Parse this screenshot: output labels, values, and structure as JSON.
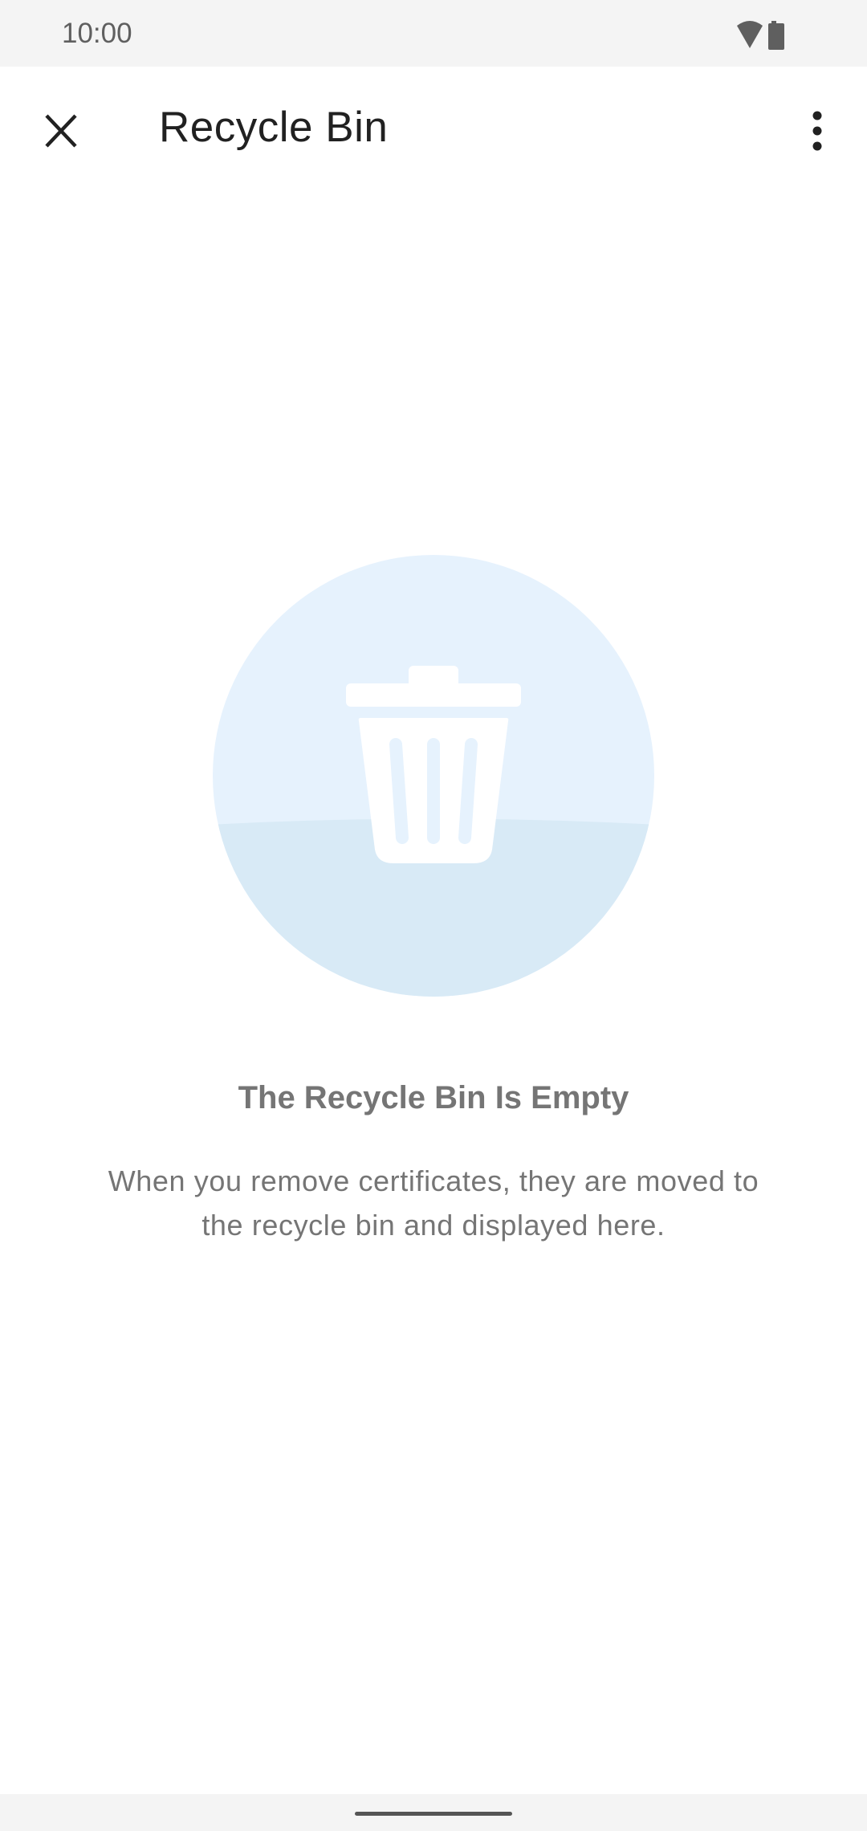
{
  "status_bar": {
    "time": "10:00",
    "icons": [
      "wifi-icon",
      "battery-icon"
    ]
  },
  "toolbar": {
    "title": "Recycle Bin",
    "close_icon": "close-icon",
    "menu_icon": "more-vert-icon"
  },
  "empty_state": {
    "icon": "trash-icon",
    "heading": "The Recycle Bin Is Empty",
    "line1": "When you remove certificates, they are moved to",
    "line2": "the recycle bin and displayed here."
  },
  "colors": {
    "circle_top": "#e6f2fd",
    "circle_bottom": "#d8eaf6",
    "text_secondary": "#757575"
  }
}
